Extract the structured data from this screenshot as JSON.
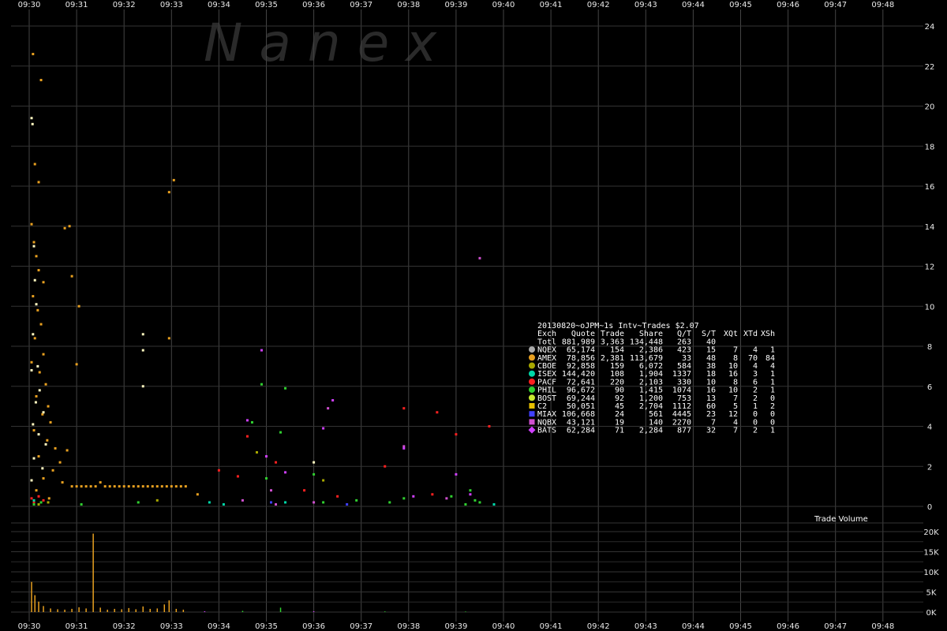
{
  "watermark": "N a n e x",
  "volume_label": "Trade Volume",
  "chart_data": {
    "type": "scatter",
    "x_ticks": [
      "09:30",
      "09:31",
      "09:32",
      "09:33",
      "09:34",
      "09:35",
      "09:36",
      "09:37",
      "09:38",
      "09:39",
      "09:40",
      "09:41",
      "09:42",
      "09:43",
      "09:44",
      "09:45",
      "09:46",
      "09:47",
      "09:48"
    ],
    "y_ticks": [
      0,
      2,
      4,
      6,
      8,
      10,
      12,
      14,
      16,
      18,
      20,
      22,
      24
    ],
    "ylim": [
      0,
      24
    ],
    "volume_ticks": [
      "0K",
      "5K",
      "10K",
      "15K",
      "20K"
    ],
    "volume_ylim": [
      0,
      20000
    ],
    "grid": true,
    "stats_table": {
      "title": "20130820~oJPM~1s Intv~Trades $2.07",
      "headers": [
        "Exch",
        "Quote",
        "Trade",
        "Share",
        "Q/T",
        "S/T",
        "XQt",
        "XTd",
        "XSh"
      ],
      "rows": [
        {
          "exch": "Totl",
          "color": "",
          "marker": "none",
          "values": [
            "881,989",
            "3,363",
            "134,448",
            "263",
            "40",
            "",
            "",
            ""
          ]
        },
        {
          "exch": "NQEX",
          "color": "#aaaaaa",
          "marker": "circle",
          "values": [
            "65,174",
            "154",
            "2,386",
            "423",
            "15",
            "7",
            "4",
            "1"
          ]
        },
        {
          "exch": "AMEX",
          "color": "#e8a020",
          "marker": "circle",
          "values": [
            "78,856",
            "2,381",
            "113,679",
            "33",
            "48",
            "8",
            "70",
            "84"
          ]
        },
        {
          "exch": "CBOE",
          "color": "#a8a800",
          "marker": "circle",
          "values": [
            "92,858",
            "159",
            "6,072",
            "584",
            "38",
            "10",
            "4",
            "4"
          ]
        },
        {
          "exch": "ISEX",
          "color": "#00d8a8",
          "marker": "circle",
          "values": [
            "144,420",
            "108",
            "1,904",
            "1337",
            "18",
            "16",
            "3",
            "1"
          ]
        },
        {
          "exch": "PACF",
          "color": "#ff2020",
          "marker": "circle",
          "values": [
            "72,641",
            "220",
            "2,103",
            "330",
            "10",
            "8",
            "6",
            "1"
          ]
        },
        {
          "exch": "PHIL",
          "color": "#30d030",
          "marker": "circle",
          "values": [
            "96,672",
            "90",
            "1,415",
            "1074",
            "16",
            "10",
            "2",
            "1"
          ]
        },
        {
          "exch": "BOST",
          "color": "#c8e830",
          "marker": "circle",
          "values": [
            "69,244",
            "92",
            "1,200",
            "753",
            "13",
            "7",
            "2",
            "0"
          ]
        },
        {
          "exch": "C2",
          "color": "#e8c000",
          "marker": "square",
          "values": [
            "50,051",
            "45",
            "2,704",
            "1112",
            "60",
            "5",
            "1",
            "2"
          ]
        },
        {
          "exch": "MIAX",
          "color": "#4040ff",
          "marker": "square",
          "values": [
            "106,668",
            "24",
            "561",
            "4445",
            "23",
            "12",
            "0",
            "0"
          ]
        },
        {
          "exch": "NQBX",
          "color": "#d050d0",
          "marker": "square",
          "values": [
            "43,121",
            "19",
            "140",
            "2270",
            "7",
            "4",
            "0",
            "0"
          ]
        },
        {
          "exch": "BATS",
          "color": "#d040ff",
          "marker": "diamond",
          "values": [
            "62,284",
            "71",
            "2,284",
            "877",
            "32",
            "7",
            "2",
            "1"
          ]
        }
      ]
    },
    "series": [
      {
        "exch": "AMEX",
        "color": "#e8a020",
        "points": [
          [
            0.08,
            22.6
          ],
          [
            0.25,
            21.3
          ],
          [
            0.12,
            17.1
          ],
          [
            0.2,
            16.2
          ],
          [
            0.05,
            14.1
          ],
          [
            0.1,
            13.2
          ],
          [
            0.15,
            12.5
          ],
          [
            0.2,
            11.8
          ],
          [
            0.3,
            11.2
          ],
          [
            0.08,
            10.5
          ],
          [
            0.18,
            9.8
          ],
          [
            0.25,
            9.1
          ],
          [
            0.12,
            8.4
          ],
          [
            0.3,
            7.6
          ],
          [
            0.05,
            7.2
          ],
          [
            0.22,
            6.7
          ],
          [
            0.35,
            6.1
          ],
          [
            0.15,
            5.5
          ],
          [
            0.4,
            5.0
          ],
          [
            0.28,
            4.6
          ],
          [
            0.45,
            4.2
          ],
          [
            0.1,
            3.8
          ],
          [
            0.38,
            3.3
          ],
          [
            0.55,
            2.9
          ],
          [
            0.2,
            2.5
          ],
          [
            0.65,
            2.2
          ],
          [
            0.5,
            1.8
          ],
          [
            0.3,
            1.4
          ],
          [
            0.7,
            1.2
          ],
          [
            0.15,
            0.8
          ],
          [
            0.42,
            0.4
          ],
          [
            0.8,
            2.8
          ],
          [
            0.9,
            1.0
          ],
          [
            1.0,
            1.0
          ],
          [
            1.1,
            1.0
          ],
          [
            1.2,
            1.0
          ],
          [
            1.3,
            1.0
          ],
          [
            1.4,
            1.0
          ],
          [
            1.5,
            1.2
          ],
          [
            1.6,
            1.0
          ],
          [
            1.7,
            1.0
          ],
          [
            1.8,
            1.0
          ],
          [
            1.9,
            1.0
          ],
          [
            2.0,
            1.0
          ],
          [
            2.1,
            1.0
          ],
          [
            2.2,
            1.0
          ],
          [
            2.3,
            1.0
          ],
          [
            2.4,
            1.0
          ],
          [
            2.5,
            1.0
          ],
          [
            2.6,
            1.0
          ],
          [
            2.7,
            1.0
          ],
          [
            2.8,
            1.0
          ],
          [
            2.9,
            1.0
          ],
          [
            3.0,
            1.0
          ],
          [
            3.1,
            1.0
          ],
          [
            3.2,
            1.0
          ],
          [
            3.3,
            1.0
          ],
          [
            3.05,
            16.3
          ],
          [
            2.95,
            15.7
          ],
          [
            2.95,
            8.4
          ],
          [
            3.55,
            0.6
          ],
          [
            0.85,
            14.0
          ],
          [
            0.75,
            13.9
          ],
          [
            0.9,
            11.5
          ],
          [
            1.0,
            7.1
          ],
          [
            1.05,
            10.0
          ]
        ]
      },
      {
        "exch": "BOST",
        "color": "#fff8c0",
        "points": [
          [
            0.05,
            19.4
          ],
          [
            0.07,
            19.1
          ],
          [
            0.1,
            13.0
          ],
          [
            0.12,
            11.3
          ],
          [
            0.15,
            10.1
          ],
          [
            0.08,
            8.6
          ],
          [
            0.18,
            7.0
          ],
          [
            0.05,
            6.8
          ],
          [
            0.22,
            5.8
          ],
          [
            0.14,
            5.2
          ],
          [
            0.3,
            4.7
          ],
          [
            0.08,
            4.1
          ],
          [
            0.2,
            3.6
          ],
          [
            0.35,
            3.1
          ],
          [
            0.1,
            2.4
          ],
          [
            0.28,
            1.9
          ],
          [
            0.05,
            1.3
          ],
          [
            2.4,
            8.6
          ],
          [
            2.4,
            7.8
          ],
          [
            2.4,
            6.0
          ],
          [
            6.0,
            2.2
          ]
        ]
      },
      {
        "exch": "PACF",
        "color": "#ff2020",
        "points": [
          [
            0.05,
            0.4
          ],
          [
            0.1,
            0.2
          ],
          [
            0.2,
            0.5
          ],
          [
            0.3,
            0.3
          ],
          [
            4.0,
            1.8
          ],
          [
            4.4,
            1.5
          ],
          [
            4.6,
            3.5
          ],
          [
            5.2,
            2.2
          ],
          [
            5.8,
            0.8
          ],
          [
            6.5,
            0.5
          ],
          [
            7.5,
            2.0
          ],
          [
            7.9,
            4.9
          ],
          [
            8.6,
            4.7
          ],
          [
            9.0,
            3.6
          ],
          [
            9.7,
            4.0
          ],
          [
            8.5,
            0.6
          ]
        ]
      },
      {
        "exch": "PHIL",
        "color": "#30d030",
        "points": [
          [
            0.1,
            0.1
          ],
          [
            0.25,
            0.2
          ],
          [
            1.1,
            0.1
          ],
          [
            2.3,
            0.2
          ],
          [
            4.9,
            6.1
          ],
          [
            4.7,
            4.2
          ],
          [
            5.0,
            1.4
          ],
          [
            5.3,
            3.7
          ],
          [
            6.2,
            0.2
          ],
          [
            6.9,
            0.3
          ],
          [
            7.6,
            0.2
          ],
          [
            7.9,
            0.4
          ],
          [
            8.9,
            0.5
          ],
          [
            9.3,
            0.8
          ],
          [
            9.5,
            0.2
          ],
          [
            9.2,
            0.1
          ],
          [
            9.4,
            0.3
          ],
          [
            6.0,
            1.6
          ],
          [
            5.4,
            5.9
          ]
        ]
      },
      {
        "exch": "NQBX",
        "color": "#d050d0",
        "points": [
          [
            4.5,
            0.3
          ],
          [
            5.1,
            0.8
          ],
          [
            5.2,
            0.1
          ],
          [
            6.0,
            0.2
          ],
          [
            6.3,
            4.9
          ],
          [
            9.5,
            12.4
          ],
          [
            8.8,
            0.4
          ],
          [
            7.9,
            3.0
          ]
        ]
      },
      {
        "exch": "ISEX",
        "color": "#00d8a8",
        "points": [
          [
            0.1,
            0.3
          ],
          [
            3.8,
            0.2
          ],
          [
            4.1,
            0.1
          ],
          [
            5.4,
            0.2
          ],
          [
            9.8,
            0.1
          ]
        ]
      },
      {
        "exch": "BATS",
        "color": "#d040ff",
        "points": [
          [
            4.6,
            4.3
          ],
          [
            4.9,
            7.8
          ],
          [
            5.0,
            2.5
          ],
          [
            5.4,
            1.7
          ],
          [
            6.2,
            3.9
          ],
          [
            6.4,
            5.3
          ],
          [
            7.9,
            2.9
          ],
          [
            8.1,
            0.5
          ],
          [
            9.0,
            1.6
          ],
          [
            9.3,
            0.6
          ]
        ]
      },
      {
        "exch": "MIAX",
        "color": "#4040ff",
        "points": [
          [
            5.1,
            0.2
          ],
          [
            6.7,
            0.1
          ]
        ]
      },
      {
        "exch": "CBOE",
        "color": "#a8a800",
        "points": [
          [
            0.2,
            0.1
          ],
          [
            0.4,
            0.2
          ],
          [
            2.7,
            0.3
          ],
          [
            4.8,
            2.7
          ],
          [
            6.2,
            1.3
          ]
        ]
      }
    ],
    "volume_series": [
      {
        "x": 0.05,
        "v": 7500,
        "color": "#e8a020"
      },
      {
        "x": 0.12,
        "v": 4200,
        "color": "#e8a020"
      },
      {
        "x": 0.2,
        "v": 2600,
        "color": "#e8a020"
      },
      {
        "x": 0.3,
        "v": 1500,
        "color": "#e8a020"
      },
      {
        "x": 0.45,
        "v": 900,
        "color": "#e8a020"
      },
      {
        "x": 0.6,
        "v": 700,
        "color": "#e8a020"
      },
      {
        "x": 0.75,
        "v": 600,
        "color": "#e8a020"
      },
      {
        "x": 0.9,
        "v": 800,
        "color": "#e8a020"
      },
      {
        "x": 1.05,
        "v": 1200,
        "color": "#e8a020"
      },
      {
        "x": 1.2,
        "v": 900,
        "color": "#e8a020"
      },
      {
        "x": 1.35,
        "v": 19500,
        "color": "#e8a020"
      },
      {
        "x": 1.5,
        "v": 1100,
        "color": "#e8a020"
      },
      {
        "x": 1.65,
        "v": 600,
        "color": "#e8a020"
      },
      {
        "x": 1.8,
        "v": 800,
        "color": "#e8a020"
      },
      {
        "x": 1.95,
        "v": 700,
        "color": "#e8a020"
      },
      {
        "x": 2.1,
        "v": 1000,
        "color": "#e8a020"
      },
      {
        "x": 2.25,
        "v": 700,
        "color": "#e8a020"
      },
      {
        "x": 2.4,
        "v": 1400,
        "color": "#e8a020"
      },
      {
        "x": 2.55,
        "v": 800,
        "color": "#e8a020"
      },
      {
        "x": 2.7,
        "v": 900,
        "color": "#e8a020"
      },
      {
        "x": 2.85,
        "v": 1900,
        "color": "#e8a020"
      },
      {
        "x": 2.95,
        "v": 2900,
        "color": "#e8a020"
      },
      {
        "x": 3.1,
        "v": 800,
        "color": "#e8a020"
      },
      {
        "x": 3.25,
        "v": 600,
        "color": "#e8a020"
      },
      {
        "x": 3.7,
        "v": 200,
        "color": "#d040ff"
      },
      {
        "x": 4.5,
        "v": 300,
        "color": "#30d030"
      },
      {
        "x": 5.3,
        "v": 1100,
        "color": "#30d030"
      },
      {
        "x": 6.0,
        "v": 200,
        "color": "#d040ff"
      },
      {
        "x": 7.5,
        "v": 150,
        "color": "#30d030"
      },
      {
        "x": 9.2,
        "v": 120,
        "color": "#30d030"
      }
    ]
  }
}
